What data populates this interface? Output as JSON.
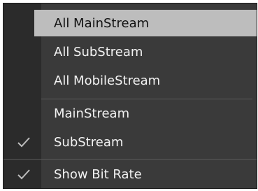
{
  "menu": {
    "items": [
      {
        "label": "All MainStream",
        "checked": false,
        "highlighted": true
      },
      {
        "label": "All SubStream",
        "checked": false,
        "highlighted": false
      },
      {
        "label": "All MobileStream",
        "checked": false,
        "highlighted": false
      },
      {
        "label": "MainStream",
        "checked": false,
        "highlighted": false
      },
      {
        "label": "SubStream",
        "checked": true,
        "highlighted": false
      },
      {
        "label": "Show Bit Rate",
        "checked": true,
        "highlighted": false
      }
    ]
  },
  "colors": {
    "menu_bg": "#3a3a3a",
    "gutter_bg": "#2b2b2b",
    "highlight_bg": "#bdbdbd",
    "text": "#f2f2f2",
    "check": "#bdbdbd"
  }
}
